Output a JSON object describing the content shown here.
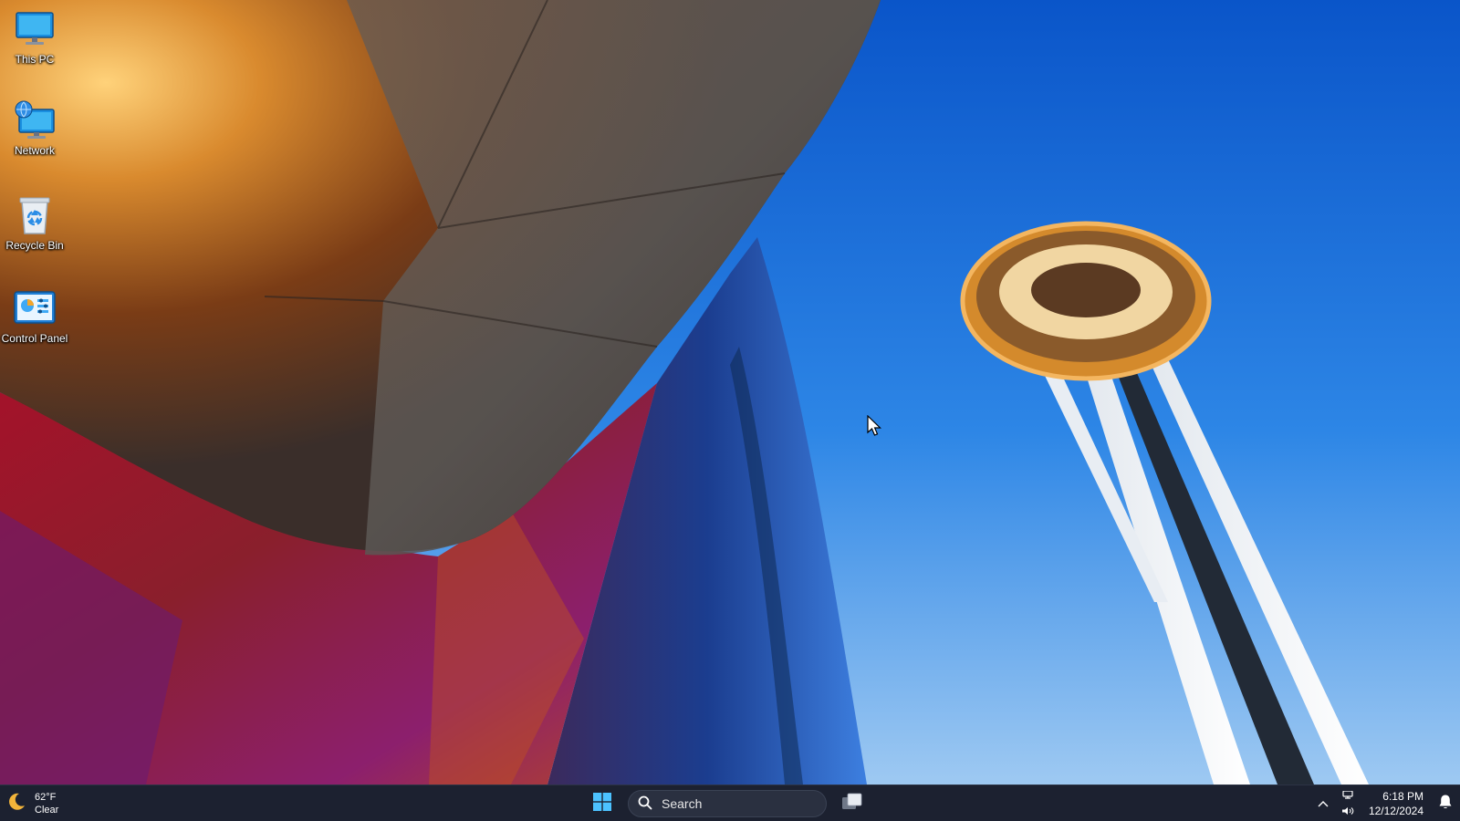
{
  "desktop": {
    "icons": [
      {
        "label": "This PC",
        "icon": "monitor-icon"
      },
      {
        "label": "Network",
        "icon": "network-icon"
      },
      {
        "label": "Recycle Bin",
        "icon": "recycle-bin-icon"
      },
      {
        "label": "Control Panel",
        "icon": "control-panel-icon"
      }
    ]
  },
  "taskbar": {
    "weather": {
      "temperature": "62°F",
      "condition": "Clear",
      "icon": "moon-icon"
    },
    "start_icon": "windows-logo-icon",
    "search": {
      "label": "Search",
      "icon": "search-icon"
    },
    "task_view_icon": "task-view-icon",
    "tray": {
      "overflow_icon": "chevron-up-icon",
      "network_icon": "network-status-icon",
      "volume_icon": "volume-icon",
      "time": "6:18 PM",
      "date": "12/12/2024",
      "notification_icon": "bell-icon"
    }
  },
  "colors": {
    "taskbar_bg": "#1c2130",
    "sky_blue": "#1e6fd9",
    "copper": "#c0661e",
    "accent_blue": "#3b9ff2"
  }
}
